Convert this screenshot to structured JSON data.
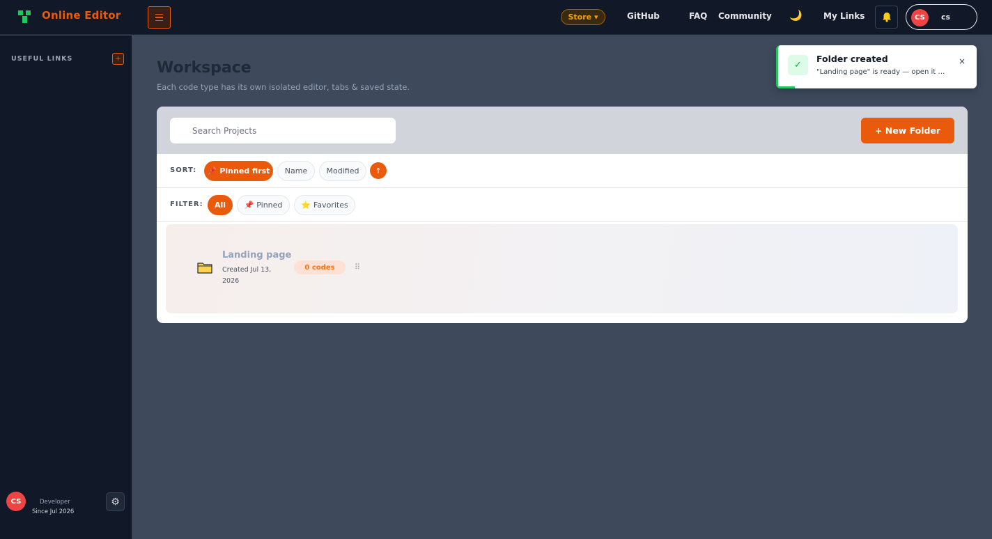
{
  "header": {
    "brand": "Online Editor",
    "store_label": "Store ▾",
    "nav": [
      "GitHub",
      "FAQ",
      "Community",
      "My Links"
    ],
    "user_initials": "CS",
    "user_name": "cs"
  },
  "sidebar": {
    "title": "USEFUL LINKS",
    "add_label": "+",
    "user_initials": "CS",
    "role": "Developer",
    "since": "Since Jul 2026"
  },
  "main": {
    "title": "Workspace",
    "subtitle": "Each code type has its own isolated editor, tabs & saved state.",
    "search_placeholder": "Search Projects",
    "new_folder_label": "+ New Folder",
    "sort": {
      "label": "SORT:",
      "options": [
        "Pinned first",
        "Name",
        "Modified"
      ],
      "active": "Pinned first",
      "direction_label": "↑"
    },
    "filter": {
      "label": "FILTER:",
      "options": [
        "All",
        "Pinned",
        "Favorites"
      ],
      "active": "All"
    },
    "folders": [
      {
        "name": "Landing page",
        "created": "Created Jul 13, 2026",
        "codes": "0 codes",
        "handle": "⠿"
      }
    ]
  },
  "toast": {
    "title": "Folder created",
    "message": "\"Landing page\" is ready — open it and start coding",
    "close": "×",
    "check": "✓"
  },
  "colors": {
    "accent": "#ea5a0c",
    "success": "#22c55e",
    "topbar": "#111827",
    "background": "#3e4a5c"
  }
}
